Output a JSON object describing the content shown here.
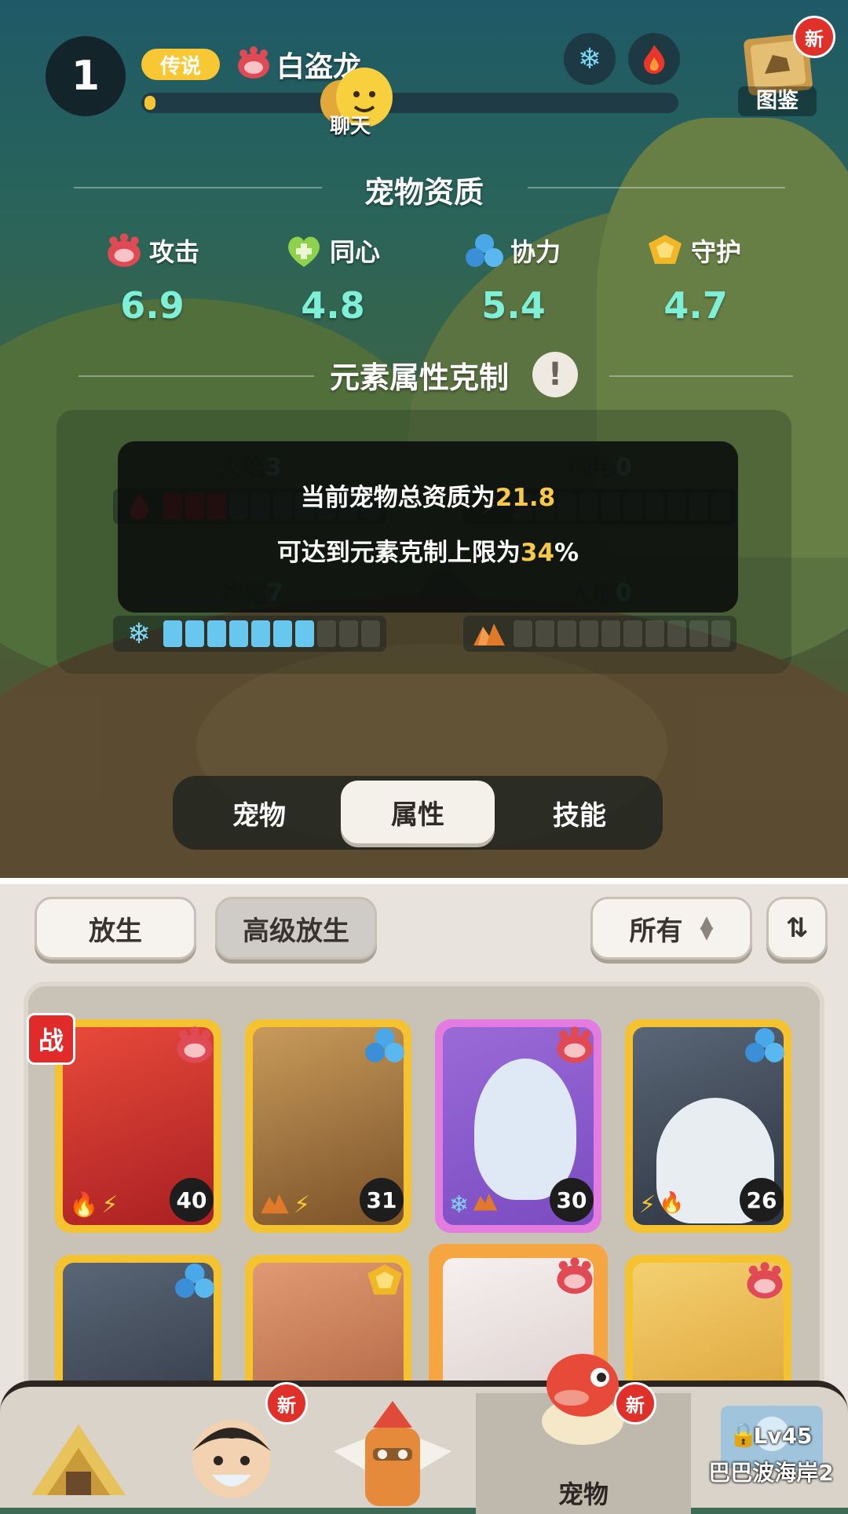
{
  "header": {
    "level": "1",
    "rarity": "传说",
    "pet_name": "白盗龙",
    "exp_progress": 0.02,
    "chat_label": "聊天",
    "codex_label": "图鉴",
    "codex_badge": "新",
    "element_buttons": [
      "snowflake-icon",
      "flame-icon"
    ]
  },
  "aptitude": {
    "title": "宠物资质",
    "stats": [
      {
        "label": "攻击",
        "value": "6.9",
        "icon": "attack-claw-icon"
      },
      {
        "label": "同心",
        "value": "4.8",
        "icon": "heart-icon"
      },
      {
        "label": "协力",
        "value": "5.4",
        "icon": "cooperation-icon"
      },
      {
        "label": "守护",
        "value": "4.7",
        "icon": "guard-icon"
      }
    ]
  },
  "elements": {
    "title": "元素属性克制",
    "info_icon": "!",
    "items": [
      {
        "name": "火焰",
        "value": "3",
        "filled": 3,
        "total": 10,
        "color": "#c0262a"
      },
      {
        "name": "闪电",
        "value": "0",
        "filled": 0,
        "total": 10,
        "color": "#f5c633"
      },
      {
        "name": "冰霜",
        "value": "7",
        "filled": 7,
        "total": 10,
        "color": "#68c7ee"
      },
      {
        "name": "大地",
        "value": "0",
        "filled": 0,
        "total": 10,
        "color": "#e07a2a"
      }
    ]
  },
  "tooltip": {
    "line1_prefix": "当前宠物总资质为",
    "line1_value": "21.8",
    "line2_prefix": "可达到元素克制上限为",
    "line2_value": "34",
    "line2_suffix": "%"
  },
  "tabs": [
    {
      "label": "宠物",
      "active": false
    },
    {
      "label": "属性",
      "active": true
    },
    {
      "label": "技能",
      "active": false
    }
  ],
  "actions": {
    "release": "放生",
    "advanced_release": "高级放生",
    "filter": "所有",
    "sort_icon": "sort-icon"
  },
  "pets": [
    {
      "level": "40",
      "frame": "gold",
      "type": "attack",
      "battle": "战",
      "elements": [
        "fire",
        "lightning"
      ],
      "art": "#c7282b"
    },
    {
      "level": "31",
      "frame": "gold",
      "type": "cooperation",
      "elements": [
        "earth",
        "lightning"
      ],
      "art": "#9b6a3a"
    },
    {
      "level": "30",
      "frame": "epic",
      "type": "attack",
      "elements": [
        "ice",
        "earth"
      ],
      "art": "#b9d4ef"
    },
    {
      "level": "26",
      "frame": "gold",
      "type": "cooperation",
      "elements": [
        "lightning",
        "fire"
      ],
      "art": "#3a4653"
    },
    {
      "level": "",
      "frame": "gold",
      "type": "cooperation",
      "elements": [],
      "art": "#3a4653"
    },
    {
      "level": "",
      "frame": "gold",
      "type": "guard",
      "elements": [],
      "art": "#b86a4a"
    },
    {
      "level": "",
      "frame": "selected",
      "type": "attack",
      "elements": [],
      "art": "#e8e4e4"
    },
    {
      "level": "",
      "frame": "gold",
      "type": "attack",
      "elements": [],
      "art": "#f0c04a"
    }
  ],
  "nav": {
    "items": [
      {
        "label": "",
        "icon": "hut-icon"
      },
      {
        "label": "",
        "icon": "character-icon",
        "badge": "新"
      },
      {
        "label": "",
        "icon": "totem-icon"
      },
      {
        "label": "宠物",
        "icon": "pet-icon",
        "badge": "新",
        "active": true
      },
      {
        "label": "Lv45",
        "label2": "巴巴波海岸2",
        "icon": "map-icon",
        "locked": true
      }
    ]
  }
}
